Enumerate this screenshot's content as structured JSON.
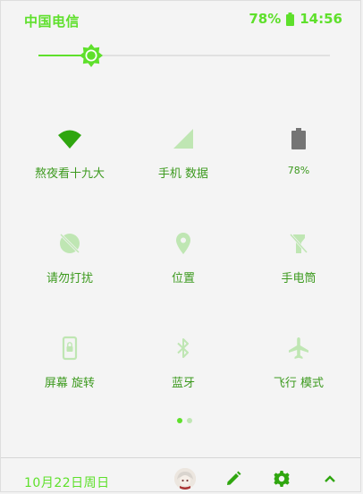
{
  "status_bar": {
    "carrier": "中国电信",
    "battery_percent": "78%",
    "time": "14:56"
  },
  "brightness": {
    "level": 0.18
  },
  "tiles": [
    {
      "label": "熬夜看十九大",
      "icon": "wifi-icon",
      "active": true
    },
    {
      "label": "手机 数据",
      "icon": "cellular-signal-icon",
      "active": false
    },
    {
      "label": "78%",
      "icon": "battery-icon",
      "active": false
    },
    {
      "label": "请勿打扰",
      "icon": "do-not-disturb-icon",
      "active": false
    },
    {
      "label": "位置",
      "icon": "location-pin-icon",
      "active": false
    },
    {
      "label": "手电筒",
      "icon": "flashlight-off-icon",
      "active": false
    },
    {
      "label": "屏幕 旋转",
      "icon": "screen-rotation-lock-icon",
      "active": false
    },
    {
      "label": "蓝牙",
      "icon": "bluetooth-icon",
      "active": false
    },
    {
      "label": "飞行 模式",
      "icon": "airplane-icon",
      "active": false
    }
  ],
  "page_indicator": {
    "pages": 2,
    "current": 0
  },
  "bottom_bar": {
    "date": "10月22日周日"
  },
  "colors": {
    "accent": "#5ee02b",
    "accent_dark": "#2fa60f",
    "inactive": "#bfe6b3",
    "label": "#3d9a1f",
    "battery_gray": "#757575"
  }
}
